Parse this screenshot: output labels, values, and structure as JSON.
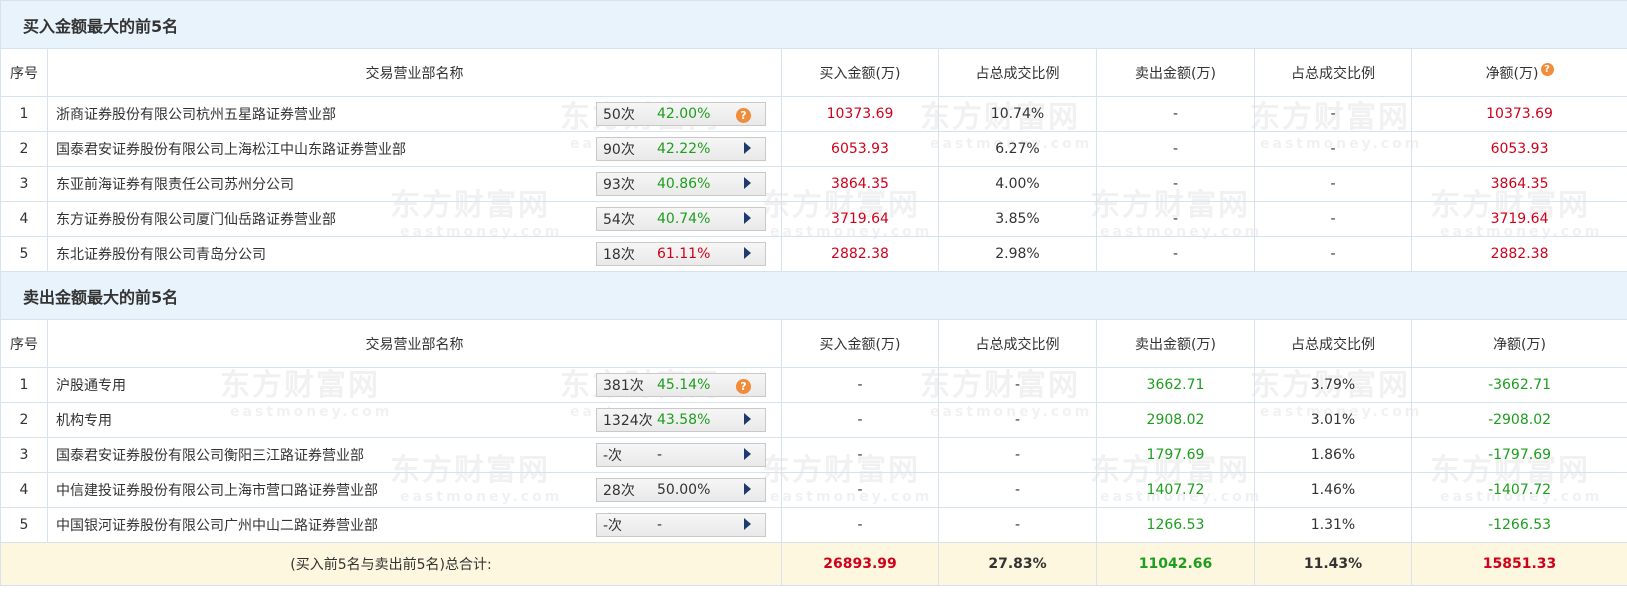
{
  "watermark": {
    "cn": "东方财富网",
    "en": "eastmoney.com"
  },
  "buy_section": {
    "title": "买入金额最大的前5名",
    "headers": [
      "序号",
      "交易营业部名称",
      "买入金额(万)",
      "占总成交比例",
      "卖出金额(万)",
      "占总成交比例",
      "净额(万)"
    ],
    "rows": [
      {
        "idx": "1",
        "name": "浙商证券股份有限公司杭州五星路证券营业部",
        "count": "50次",
        "rate": "42.00%",
        "rate_color": "green",
        "icon": "question",
        "buy": "10373.69",
        "buy_pct": "10.74%",
        "sell": "-",
        "sell_pct": "-",
        "net": "10373.69",
        "net_color": "red"
      },
      {
        "idx": "2",
        "name": "国泰君安证券股份有限公司上海松江中山东路证券营业部",
        "count": "90次",
        "rate": "42.22%",
        "rate_color": "green",
        "icon": "arrow",
        "buy": "6053.93",
        "buy_pct": "6.27%",
        "sell": "-",
        "sell_pct": "-",
        "net": "6053.93",
        "net_color": "red"
      },
      {
        "idx": "3",
        "name": "东亚前海证券有限责任公司苏州分公司",
        "count": "93次",
        "rate": "40.86%",
        "rate_color": "green",
        "icon": "arrow",
        "buy": "3864.35",
        "buy_pct": "4.00%",
        "sell": "-",
        "sell_pct": "-",
        "net": "3864.35",
        "net_color": "red"
      },
      {
        "idx": "4",
        "name": "东方证券股份有限公司厦门仙岳路证券营业部",
        "count": "54次",
        "rate": "40.74%",
        "rate_color": "green",
        "icon": "arrow",
        "buy": "3719.64",
        "buy_pct": "3.85%",
        "sell": "-",
        "sell_pct": "-",
        "net": "3719.64",
        "net_color": "red"
      },
      {
        "idx": "5",
        "name": "东北证券股份有限公司青岛分公司",
        "count": "18次",
        "rate": "61.11%",
        "rate_color": "red",
        "icon": "arrow",
        "buy": "2882.38",
        "buy_pct": "2.98%",
        "sell": "-",
        "sell_pct": "-",
        "net": "2882.38",
        "net_color": "red"
      }
    ]
  },
  "sell_section": {
    "title": "卖出金额最大的前5名",
    "headers": [
      "序号",
      "交易营业部名称",
      "买入金额(万)",
      "占总成交比例",
      "卖出金额(万)",
      "占总成交比例",
      "净额(万)"
    ],
    "rows": [
      {
        "idx": "1",
        "name": "沪股通专用",
        "count": "381次",
        "rate": "45.14%",
        "rate_color": "green",
        "icon": "question",
        "buy": "-",
        "buy_pct": "-",
        "sell": "3662.71",
        "sell_pct": "3.79%",
        "net": "-3662.71",
        "net_color": "green"
      },
      {
        "idx": "2",
        "name": "机构专用",
        "count": "1324次",
        "rate": "43.58%",
        "rate_color": "green",
        "icon": "arrow",
        "buy": "-",
        "buy_pct": "-",
        "sell": "2908.02",
        "sell_pct": "3.01%",
        "net": "-2908.02",
        "net_color": "green"
      },
      {
        "idx": "3",
        "name": "国泰君安证券股份有限公司衡阳三江路证券营业部",
        "count": "-次",
        "rate": "-",
        "rate_color": "dash",
        "icon": "arrow",
        "buy": "-",
        "buy_pct": "-",
        "sell": "1797.69",
        "sell_pct": "1.86%",
        "net": "-1797.69",
        "net_color": "green"
      },
      {
        "idx": "4",
        "name": "中信建投证券股份有限公司上海市营口路证券营业部",
        "count": "28次",
        "rate": "50.00%",
        "rate_color": "dash",
        "icon": "arrow",
        "buy": "-",
        "buy_pct": "-",
        "sell": "1407.72",
        "sell_pct": "1.46%",
        "net": "-1407.72",
        "net_color": "green"
      },
      {
        "idx": "5",
        "name": "中国银河证券股份有限公司广州中山二路证券营业部",
        "count": "-次",
        "rate": "-",
        "rate_color": "dash",
        "icon": "arrow",
        "buy": "-",
        "buy_pct": "-",
        "sell": "1266.53",
        "sell_pct": "1.31%",
        "net": "-1266.53",
        "net_color": "green"
      }
    ]
  },
  "total": {
    "label": "(买入前5名与卖出前5名)总合计:",
    "buy": "26893.99",
    "buy_pct": "27.83%",
    "sell": "11042.66",
    "sell_pct": "11.43%",
    "net": "15851.33"
  },
  "colors": {
    "red": "#d0021b",
    "green": "#1e9e1e",
    "header_bg": "#e8f3fb",
    "total_bg": "#fdf7e0"
  }
}
